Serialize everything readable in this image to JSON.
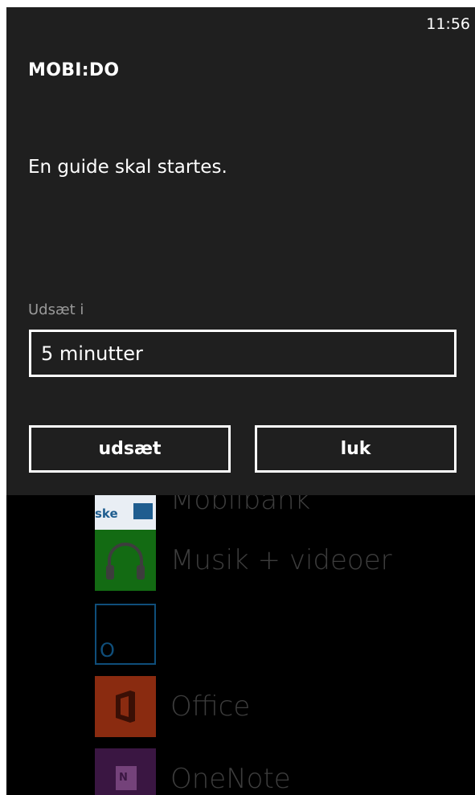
{
  "status_bar": {
    "time": "11:56"
  },
  "dialog": {
    "title": "MOBI:DO",
    "message": "En guide skal startes.",
    "snooze_label": "Udsæt i",
    "snooze_value": "5 minutter",
    "buttons": {
      "snooze": "udsæt",
      "close": "luk"
    }
  },
  "app_list": {
    "items": [
      {
        "label": "Mobilbank",
        "tile_text": "ske",
        "icon": "bank-house-icon",
        "color": "#e9eef4"
      },
      {
        "label": "Musik + videoer",
        "icon": "headphones-icon",
        "color": "#136b13"
      },
      {
        "label": "",
        "tile_text": "O",
        "icon": "o-letter-icon",
        "color": "#0f4e7a"
      },
      {
        "label": "Office",
        "icon": "office-icon",
        "color": "#8a2b10"
      },
      {
        "label": "OneNote",
        "tile_text": "N",
        "icon": "onenote-icon",
        "color": "#3a1642"
      }
    ]
  },
  "colors": {
    "dialog_background": "#1f1f1f",
    "screen_background": "#000000",
    "text": "#ffffff",
    "secondary_text": "#9a9a9a"
  }
}
